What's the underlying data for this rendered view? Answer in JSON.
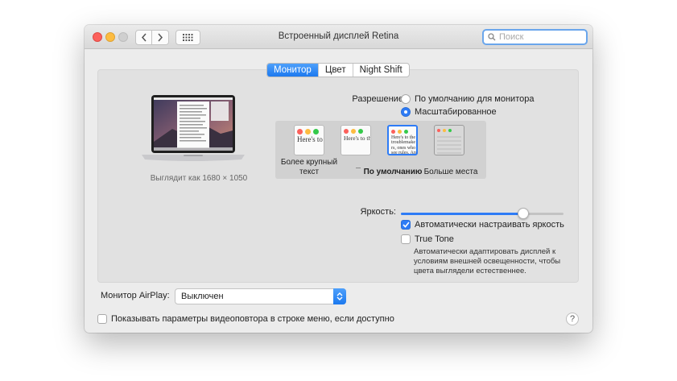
{
  "window": {
    "title": "Встроенный дисплей Retina"
  },
  "search": {
    "placeholder": "Поиск"
  },
  "tabs": [
    {
      "label": "Монитор",
      "active": true
    },
    {
      "label": "Цвет",
      "active": false
    },
    {
      "label": "Night Shift",
      "active": false
    }
  ],
  "display": {
    "caption": "Выглядит как 1680 × 1050"
  },
  "resolution": {
    "label": "Разрешение:",
    "options": [
      {
        "label": "По умолчанию для монитора",
        "selected": false
      },
      {
        "label": "Масштабированное",
        "selected": true
      }
    ],
    "thumb_text": "Here's to the troublemakers, ones who see rules. And the",
    "scale_labels": {
      "larger": "Более крупный текст",
      "default": "По умолчанию",
      "more_space": "Больше места"
    },
    "selected_index": 2
  },
  "brightness": {
    "label": "Яркость:",
    "value_fraction": 0.75,
    "auto_label": "Автоматически настраивать яркость",
    "auto_checked": true,
    "true_tone_label": "True Tone",
    "true_tone_checked": false,
    "true_tone_description": "Автоматически адаптировать дисплей к условиям внешней освещенности, чтобы цвета выглядели естественнее."
  },
  "airplay": {
    "label": "Монитор AirPlay:",
    "value": "Выключен"
  },
  "mirroring": {
    "label": "Показывать параметры видеоповтора в строке меню, если доступно",
    "checked": false
  },
  "help": {
    "label": "?"
  },
  "colors": {
    "accent": "#2e7cf6",
    "close": "#fc605b",
    "minimize": "#fdbc40",
    "zoom_disabled": "#cfcfcf"
  }
}
